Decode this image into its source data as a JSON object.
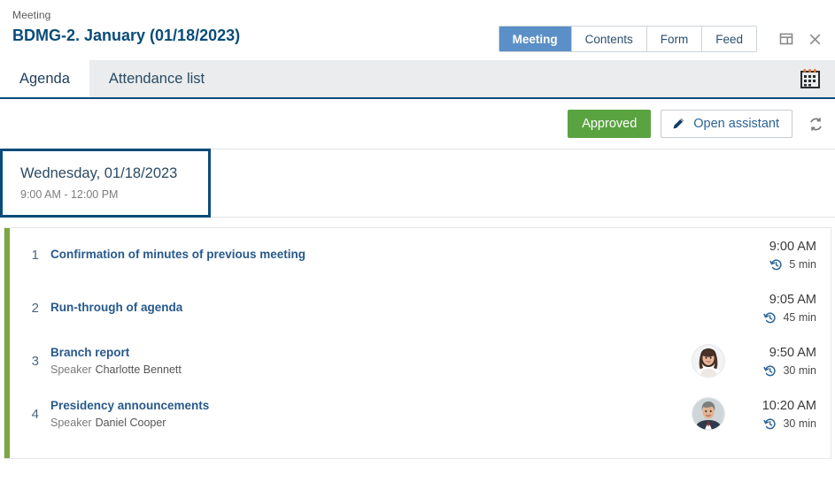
{
  "header": {
    "kind_label": "Meeting",
    "title": "BDMG-2. January (01/18/2023)",
    "view_tabs": [
      {
        "label": "Meeting",
        "active": true
      },
      {
        "label": "Contents",
        "active": false
      },
      {
        "label": "Form",
        "active": false
      },
      {
        "label": "Feed",
        "active": false
      }
    ],
    "window_icons": [
      {
        "name": "panel-layout-icon"
      },
      {
        "name": "close-icon"
      }
    ]
  },
  "tabbar": {
    "tabs": [
      {
        "label": "Agenda",
        "active": true
      },
      {
        "label": "Attendance list",
        "active": false
      }
    ],
    "calendar_icon": "calendar-icon"
  },
  "toolbar": {
    "status_label": "Approved",
    "status_color": "#5aa341",
    "assistant_label": "Open assistant",
    "assistant_icon": "pencil-icon",
    "refresh_icon": "refresh-icon"
  },
  "date_card": {
    "date_label": "Wednesday, 01/18/2023",
    "time_range": "9:00 AM - 12:00 PM",
    "border_color": "#0a4c79"
  },
  "agenda": {
    "accent_color": "#7fa63f",
    "speaker_label": "Speaker",
    "duration_icon": "history-clock-icon",
    "items": [
      {
        "number": "1",
        "title": "Confirmation of minutes of previous meeting",
        "speaker": "",
        "has_avatar": false,
        "time": "9:00 AM",
        "duration": "5 min"
      },
      {
        "number": "2",
        "title": "Run-through of agenda",
        "speaker": "",
        "has_avatar": false,
        "time": "9:05 AM",
        "duration": "45 min"
      },
      {
        "number": "3",
        "title": "Branch report",
        "speaker": "Charlotte Bennett",
        "has_avatar": true,
        "time": "9:50 AM",
        "duration": "30 min"
      },
      {
        "number": "4",
        "title": "Presidency announcements",
        "speaker": "Daniel Cooper",
        "has_avatar": true,
        "time": "10:20 AM",
        "duration": "30 min"
      }
    ]
  }
}
